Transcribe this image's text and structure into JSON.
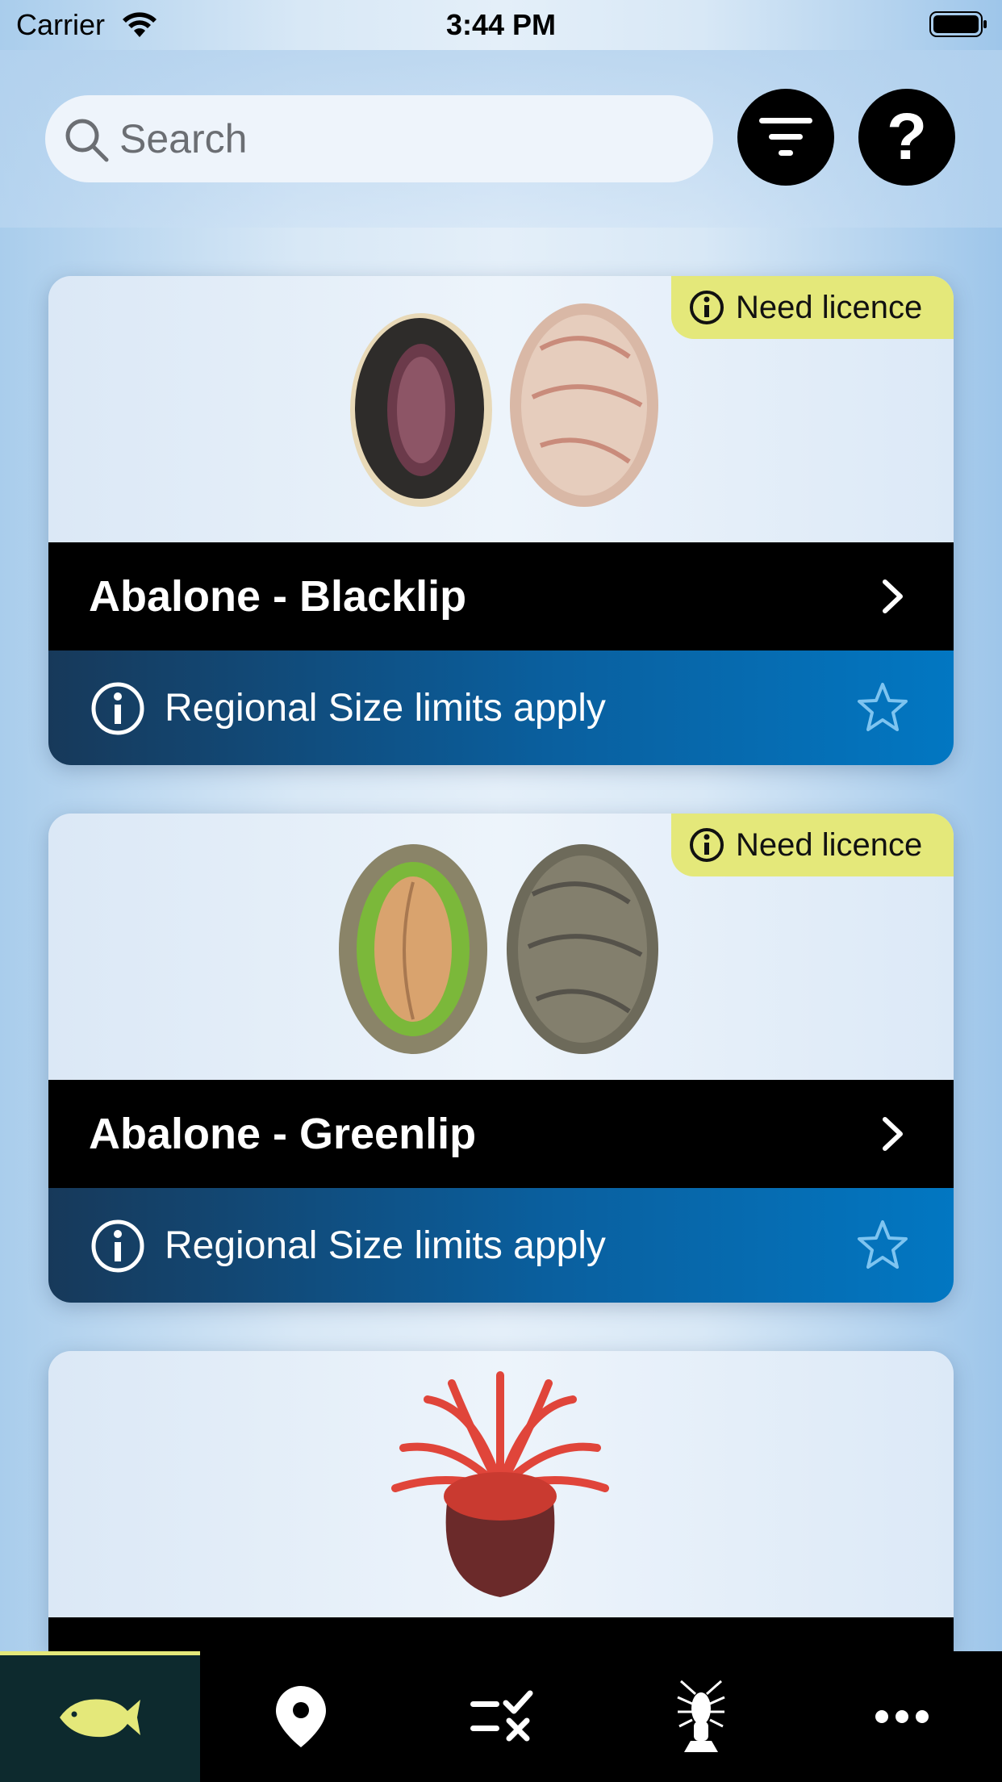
{
  "status_bar": {
    "carrier": "Carrier",
    "time": "3:44 PM"
  },
  "search": {
    "placeholder": "Search"
  },
  "header": {
    "help_label": "?"
  },
  "cards": [
    {
      "title": "Abalone - Blacklip",
      "badge": "Need licence",
      "info": "Regional Size limits apply",
      "image": "blacklip-abalone-illustration"
    },
    {
      "title": "Abalone - Greenlip",
      "badge": "Need licence",
      "info": "Regional Size limits apply",
      "image": "greenlip-abalone-illustration"
    },
    {
      "title": "",
      "badge": "",
      "info": "",
      "image": "red-sea-anemone-illustration"
    }
  ],
  "tabbar": {
    "items": [
      {
        "icon": "fish-icon",
        "active": true
      },
      {
        "icon": "location-pin-icon",
        "active": false
      },
      {
        "icon": "checklist-icon",
        "active": false
      },
      {
        "icon": "lobster-icon",
        "active": false
      },
      {
        "icon": "more-icon",
        "active": false
      }
    ]
  },
  "colors": {
    "accent": "#e4e87a",
    "info_bar_start": "#17395a",
    "info_bar_end": "#0277c2",
    "active_tab_bg": "#0d2a2e"
  }
}
